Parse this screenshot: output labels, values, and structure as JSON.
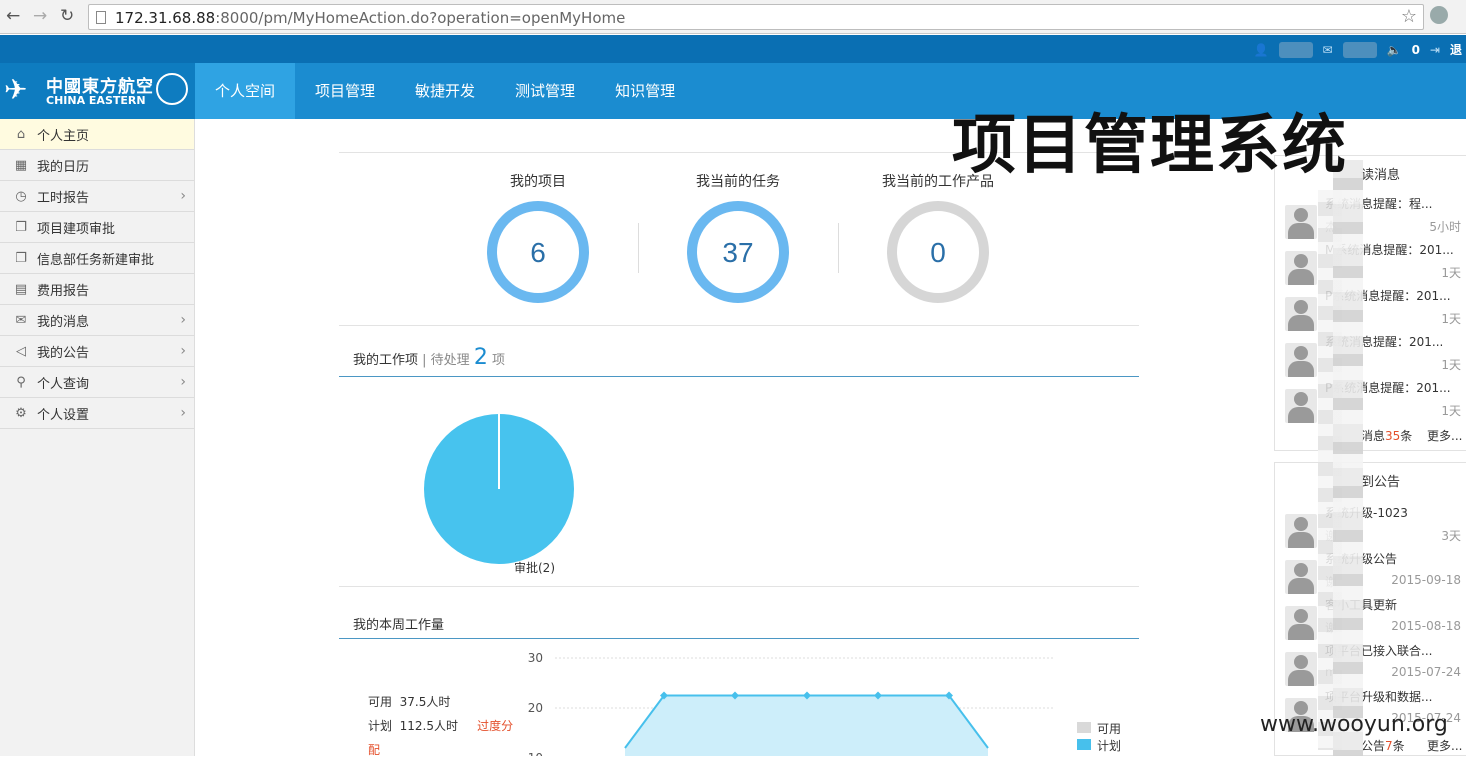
{
  "browser": {
    "url_host": "172.31.68.88",
    "url_rest": ":8000/pm/MyHomeAction.do?operation=openMyHome"
  },
  "topbar": {
    "sound_count": "0",
    "logout_label": "退"
  },
  "brand": {
    "name_cn": "中國東方航空",
    "name_en": "CHINA EASTERN"
  },
  "nav": [
    "个人空间",
    "项目管理",
    "敏捷开发",
    "测试管理",
    "知识管理"
  ],
  "sidebar": [
    {
      "label": "个人主页",
      "icon": "home-icon",
      "glyph": "⌂",
      "arrow": false,
      "active": true
    },
    {
      "label": "我的日历",
      "icon": "calendar-icon",
      "glyph": "▦",
      "arrow": false
    },
    {
      "label": "工时报告",
      "icon": "clock-report-icon",
      "glyph": "◷",
      "arrow": true
    },
    {
      "label": "项目建项审批",
      "icon": "copy-icon",
      "glyph": "❐",
      "arrow": false
    },
    {
      "label": "信息部任务新建审批",
      "icon": "copy-icon",
      "glyph": "❐",
      "arrow": false
    },
    {
      "label": "费用报告",
      "icon": "expense-icon",
      "glyph": "▤",
      "arrow": false
    },
    {
      "label": "我的消息",
      "icon": "mail-icon",
      "glyph": "✉",
      "arrow": true
    },
    {
      "label": "我的公告",
      "icon": "speaker-icon",
      "glyph": "◁",
      "arrow": true
    },
    {
      "label": "个人查询",
      "icon": "search-icon",
      "glyph": "⚲",
      "arrow": true
    },
    {
      "label": "个人设置",
      "icon": "settings-icon",
      "glyph": "⚙",
      "arrow": true
    }
  ],
  "stats": [
    {
      "label": "我的项目",
      "value": "6",
      "green_fraction": 0.25,
      "color": "#6ab8f0"
    },
    {
      "label": "我当前的任务",
      "value": "37",
      "green_fraction": 0.05,
      "color": "#6ab8f0"
    },
    {
      "label": "我当前的工作产品",
      "value": "0",
      "green_fraction": 0,
      "color": "#d6d6d6"
    }
  ],
  "workitems": {
    "title": "我的工作项",
    "pending_label": "待处理",
    "pending_count": "2",
    "unit": "项",
    "pie_label": "审批(2)"
  },
  "weekly": {
    "title": "我的本周工作量",
    "available_label": "可用",
    "available_value": "37.5人时",
    "planned_label": "计划",
    "planned_value": "112.5人时",
    "warning_1": "过度分",
    "warning_2": "配"
  },
  "chart_data": {
    "type": "area",
    "y_ticks": [
      "30",
      "20",
      "10"
    ],
    "ylim": [
      0,
      30
    ],
    "series": [
      {
        "name": "可用",
        "color": "#d9d9d9",
        "values": []
      },
      {
        "name": "计划",
        "color": "#47c0ec",
        "values": [
          12,
          22.5,
          22.5,
          22.5,
          22.5,
          22.5,
          12
        ]
      }
    ]
  },
  "messages": {
    "title": "读消息",
    "items": [
      {
        "title": "系统消息提醒：程...",
        "from": "杰",
        "time": "5小时"
      },
      {
        "title": "M系统消息提醒：201...",
        "from": "",
        "time": "1天"
      },
      {
        "title": "P系统消息提醒：201...",
        "from": "",
        "time": "1天"
      },
      {
        "title": "系统消息提醒：201...",
        "from": "",
        "time": "1天"
      },
      {
        "title": "P系统消息提醒：201...",
        "from": "",
        "time": "1天"
      }
    ],
    "footer_prefix": "消息",
    "footer_count": "35",
    "footer_suffix": "条",
    "more": "更多..."
  },
  "notices": {
    "title": "到公告",
    "items": [
      {
        "title": "系统升级-1023",
        "from": "谢",
        "time": "3天"
      },
      {
        "title": "系统升级公告",
        "from": "谢",
        "time": "2015-09-18"
      },
      {
        "title": "客小工具更新",
        "from": "谢",
        "time": "2015-08-18"
      },
      {
        "title": "项平台已接入联合...",
        "from": "m",
        "time": "2015-07-24"
      },
      {
        "title": "项平台升级和数据...",
        "from": "",
        "time": "2015-07-24"
      }
    ],
    "footer_prefix": "公告",
    "footer_count": "7",
    "footer_suffix": "条",
    "more": "更多..."
  },
  "overlay_title": "项目管理系统",
  "watermark": "www.wooyun.org"
}
